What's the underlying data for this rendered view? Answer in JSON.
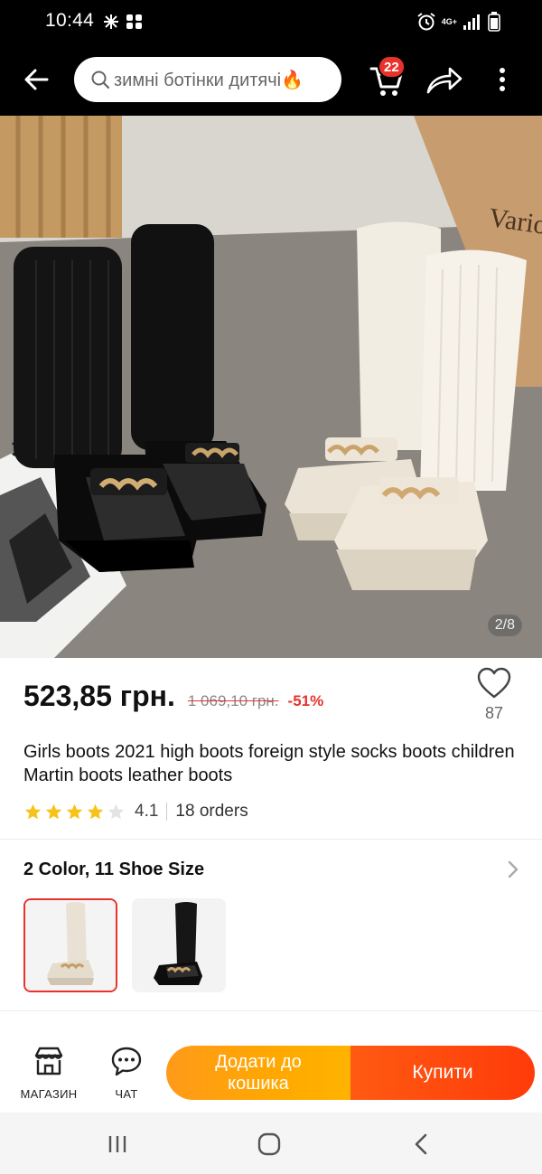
{
  "status_bar": {
    "time": "10:44",
    "network": "4G+"
  },
  "header": {
    "search_text": "зимні ботінки дитячі🔥",
    "cart_count": "22"
  },
  "gallery": {
    "counter": "2/8"
  },
  "product": {
    "price": "523,85 грн.",
    "old_price": "1 069,10 грн.",
    "discount": "-51%",
    "wishlist_count": "87",
    "title": "Girls boots 2021 high boots foreign style socks boots children Martin boots leather boots",
    "rating_stars": 4.1,
    "rating": "4.1",
    "orders": "18 orders"
  },
  "variants": {
    "title": "2 Color, 11 Shoe Size",
    "options": [
      {
        "name": "beige",
        "selected": true
      },
      {
        "name": "black",
        "selected": false
      }
    ]
  },
  "actions": {
    "store_label": "МАГАЗИН",
    "chat_label": "ЧАТ",
    "add_to_cart": "Додати до кошика",
    "buy": "Купити"
  },
  "colors": {
    "accent": "#e8322b",
    "cart_button": "#ffa800",
    "buy_button": "#ff4a0e",
    "star": "#f7c31a"
  }
}
